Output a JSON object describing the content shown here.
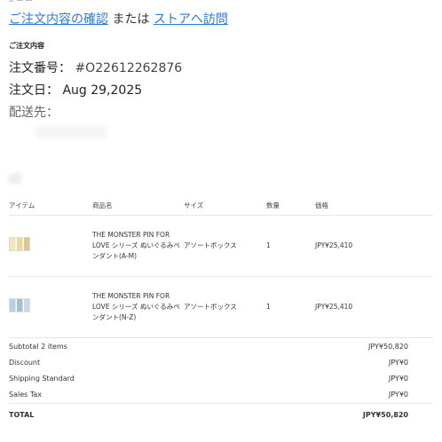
{
  "header": {
    "links": {
      "confirm_order": "ご注文内容の確認",
      "or": "または",
      "visit_store": "ストアへ訪問"
    }
  },
  "order_info": {
    "section_title": "ご注文内容",
    "order_number_label": "注文番号：",
    "order_number_value": "#O22612262876",
    "order_date_label": "注文日：",
    "order_date_value": "Aug 29,2025",
    "shipping_label": "配送先："
  },
  "table": {
    "headers": [
      "アイテム",
      "商品名",
      "サイズ",
      "数量",
      "価格"
    ],
    "rows": [
      {
        "thumb_icon": "product-thumbnail-icon",
        "name": "THE MONSTER PIN FOR LOVE シリーズ ぬいぐるみペンダント(A-M)",
        "size": "アソートボックス",
        "qty": "1",
        "price": "JPY¥25,410"
      },
      {
        "thumb_icon": "product-thumbnail-icon",
        "name": "THE MONSTER PIN FOR LOVE シリーズ ぬいぐるみペンダント(N-Z)",
        "size": "アソートボックス",
        "qty": "1",
        "price": "JPY¥25,410"
      }
    ]
  },
  "totals": {
    "subtotal_label": "Subtotal 2 items",
    "subtotal_value": "JPY¥50,820",
    "discount_label": "Discount",
    "discount_value": "JPY¥0",
    "shipping_label": "Shipping Standard",
    "shipping_value": "JPY¥0",
    "tax_label": "Sales Tax",
    "tax_value": "JPY¥0",
    "total_label": "TOTAL",
    "total_value": "JPY¥50,820"
  },
  "colors": {
    "link": "#2b7bd6",
    "text": "#222222",
    "divider": "#e6e6e6"
  }
}
